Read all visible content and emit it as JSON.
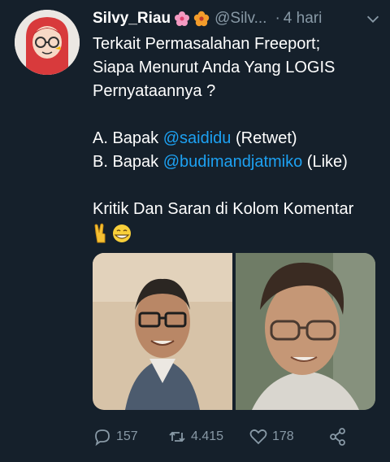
{
  "tweet": {
    "display_name": "Silvy_Riau",
    "handle": "@Silv...",
    "separator": "·",
    "time": "4 hari",
    "text_lines": [
      "Terkait Permasalahan Freeport;",
      "Siapa Menurut Anda Yang LOGIS",
      "Pernyataannya ?",
      "",
      "A. Bapak",
      "B. Bapak",
      "",
      "Kritik Dan Saran di Kolom Komentar"
    ],
    "option_a": {
      "mention": "@saididu",
      "suffix": "(Retwet)"
    },
    "option_b": {
      "mention": "@budimandjatmiko",
      "suffix": "(Like)"
    },
    "emoji_line": [
      "victory-hand-emoji",
      "grinning-face-emoji"
    ],
    "header_emoji": [
      "cherry-blossom-emoji",
      "hibiscus-emoji"
    ]
  },
  "actions": {
    "reply_count": "157",
    "retweet_count": "4.415",
    "like_count": "178"
  },
  "colors": {
    "background": "#15202b",
    "text": "#ffffff",
    "secondary": "#8899a6",
    "link": "#1da1f2"
  }
}
